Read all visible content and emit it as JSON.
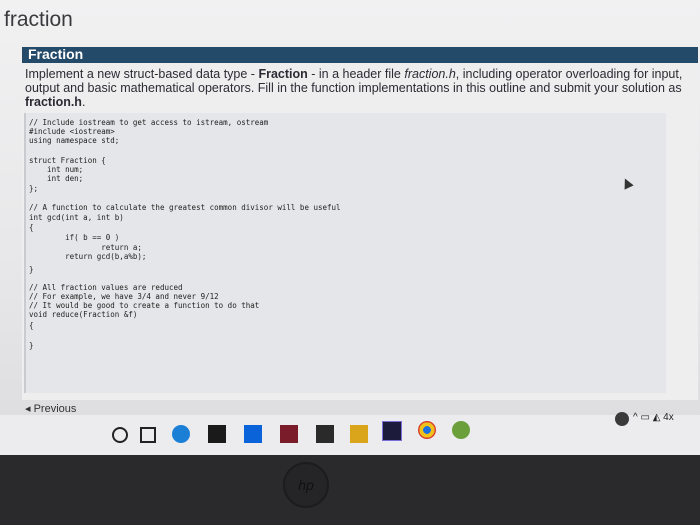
{
  "page": {
    "title": "fraction"
  },
  "section": {
    "header": "Fraction"
  },
  "instructions": {
    "p1": "Implement a new struct-based data type - ",
    "p1_bold": "Fraction",
    "p2": " - in a header file ",
    "p2_italic": "fraction.h",
    "p3": ", including operator overloading for input, output and basic mathematical operators. Fill in the function implementations in this outline and submit your solution as ",
    "p3_bold": "fraction.h",
    "p4": "."
  },
  "code": {
    "lines": [
      "// Include iostream to get access to istream, ostream",
      "#include <iostream>",
      "using namespace std;",
      "",
      "struct Fraction {",
      "    int num;",
      "    int den;",
      "};",
      "",
      "// A function to calculate the greatest common divisor will be useful",
      "int gcd(int a, int b)",
      "{",
      "        if( b == 0 )",
      "                return a;",
      "        return gcd(b,a%b);",
      "}",
      "",
      "// All fraction values are reduced",
      "// For example, we have 3/4 and never 9/12",
      "// It would be good to create a function to do that",
      "void reduce(Fraction &f)",
      "{",
      "",
      "}"
    ]
  },
  "navigation": {
    "previous_label": "◂ Previous"
  },
  "taskbar": {
    "icons": [
      "task-view-icon",
      "edge-icon",
      "store-icon",
      "dropbox-icon",
      "onenote-icon",
      "mail-icon",
      "file-explorer-icon",
      "premiere-icon",
      "chrome-icon",
      "app-icon"
    ],
    "tray": "^ ▭ ◭ 4x"
  },
  "hardware": {
    "logo_text": "hp"
  }
}
